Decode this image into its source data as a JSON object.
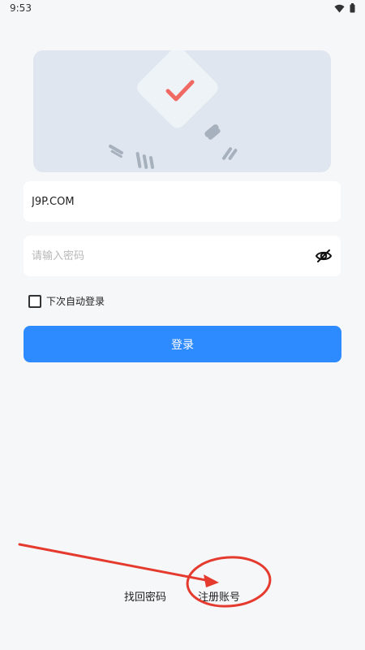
{
  "status_bar": {
    "time": "9:53"
  },
  "form": {
    "username_value": "J9P.COM",
    "password_placeholder": "请输入密码",
    "remember_label": "下次自动登录",
    "login_label": "登录"
  },
  "links": {
    "forgot": "找回密码",
    "register": "注册账号"
  },
  "colors": {
    "accent": "#2e8bff",
    "annotation": "#e53b2f",
    "check": "#f06a63"
  },
  "icons": [
    "wifi-icon",
    "battery-icon",
    "eye-off-icon",
    "checkmark-icon"
  ]
}
